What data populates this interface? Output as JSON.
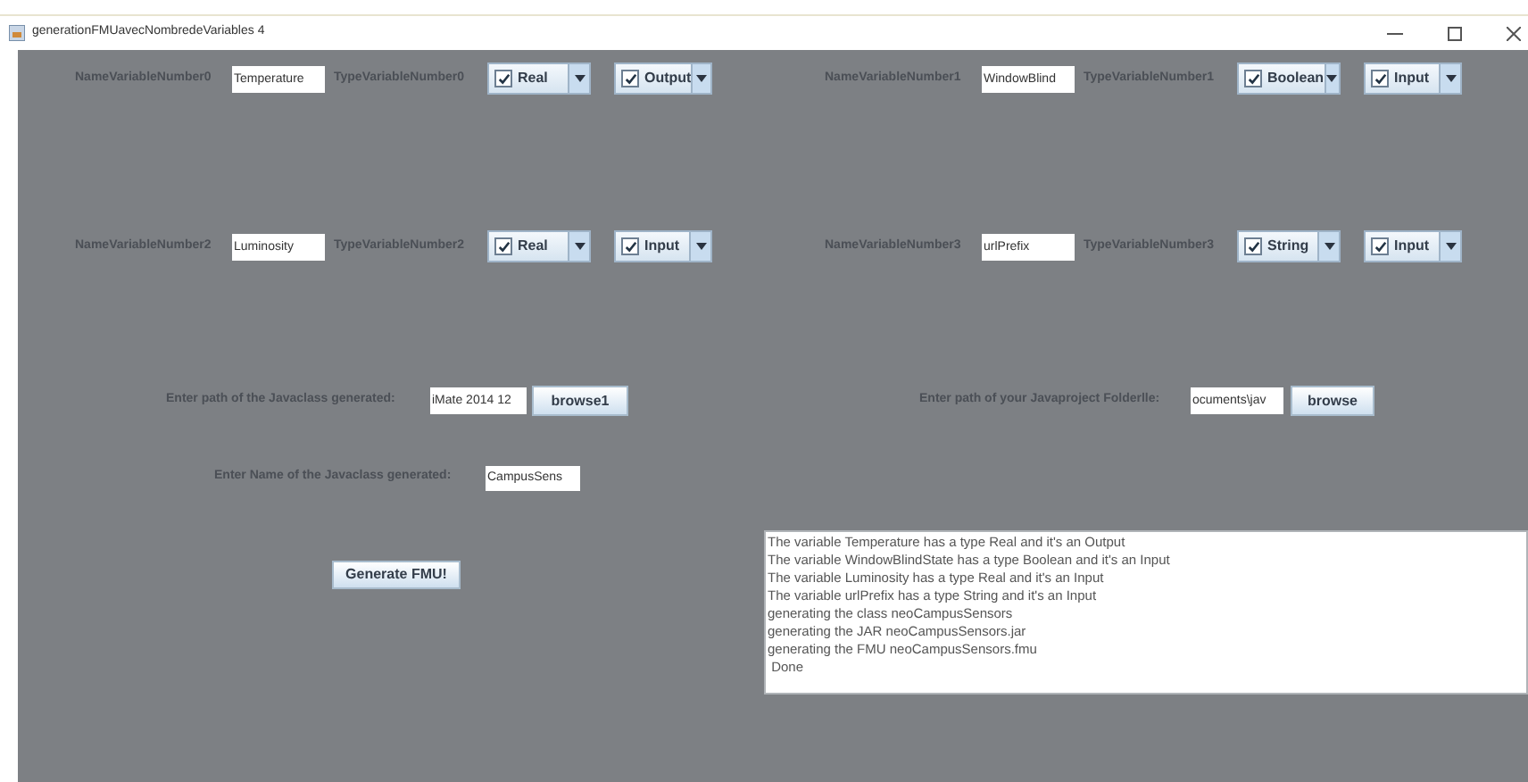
{
  "window": {
    "title": "generationFMUavecNombredeVariables 4"
  },
  "variables": [
    {
      "name_label": "NameVariableNumber0",
      "name_value": "Temperature",
      "type_label": "TypeVariableNumber0",
      "type": {
        "checked": true,
        "text": "Real"
      },
      "direction": {
        "checked": true,
        "text": "Output"
      }
    },
    {
      "name_label": "NameVariableNumber1",
      "name_value": "WindowBlind",
      "type_label": "TypeVariableNumber1",
      "type": {
        "checked": true,
        "text": "Boolean"
      },
      "direction": {
        "checked": true,
        "text": "Input"
      }
    },
    {
      "name_label": "NameVariableNumber2",
      "name_value": "Luminosity",
      "type_label": "TypeVariableNumber2",
      "type": {
        "checked": true,
        "text": "Real"
      },
      "direction": {
        "checked": true,
        "text": "Input"
      }
    },
    {
      "name_label": "NameVariableNumber3",
      "name_value": "urlPrefix",
      "type_label": "TypeVariableNumber3",
      "type": {
        "checked": true,
        "text": "String"
      },
      "direction": {
        "checked": true,
        "text": "Input"
      }
    }
  ],
  "class_path": {
    "label": "Enter path of the Javaclass generated:",
    "value": "iMate 2014 12",
    "button": "browse1"
  },
  "project_path": {
    "label": "Enter path of your Javaproject Folderlle:",
    "value": "ocuments\\jav",
    "button": "browse"
  },
  "class_name": {
    "label": "Enter Name of the Javaclass generated:",
    "value": "CampusSens"
  },
  "generate_button": "Generate FMU!",
  "log": [
    "The variable Temperature has a type Real and it's an Output",
    "The variable WindowBlindState has a type Boolean and it's an Input",
    "The variable Luminosity has a type Real and it's an Input",
    "The variable urlPrefix has a type String and it's an Input",
    "generating the class neoCampusSensors",
    "generating the JAR neoCampusSensors.jar",
    "generating the FMU neoCampusSensors.fmu",
    " Done"
  ]
}
